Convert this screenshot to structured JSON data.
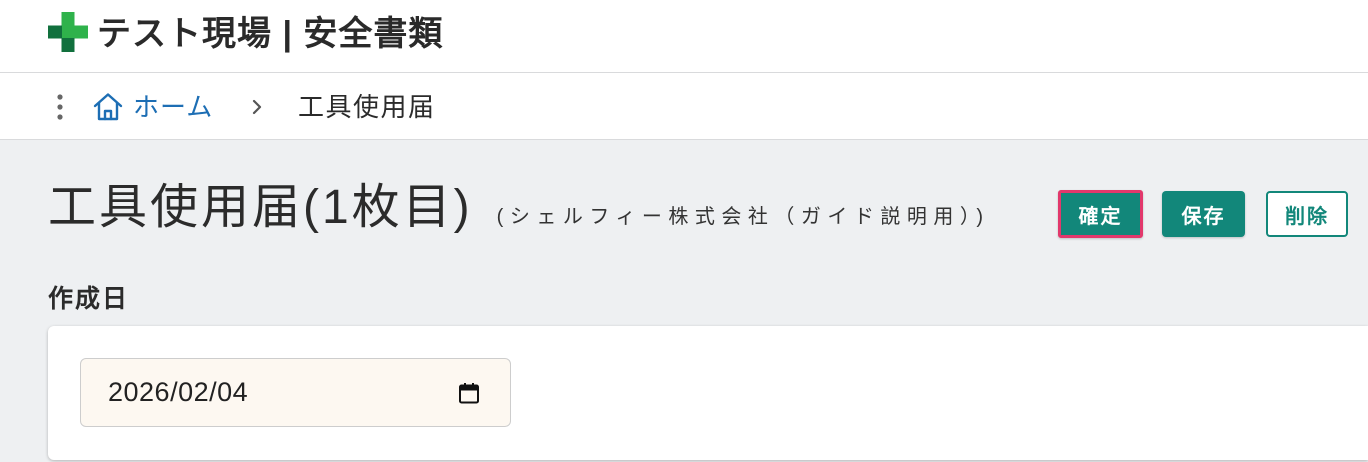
{
  "colors": {
    "brand": "#12877a",
    "highlight": "#e2386c",
    "link": "#1d6eb4",
    "background": "#eef0f2",
    "input_background": "#fdf8f1",
    "logo_light": "#2fb24b",
    "logo_dark": "#11703d"
  },
  "header": {
    "logo_icon": "green-cross-logo",
    "title": "テスト現場 | 安全書類"
  },
  "breadcrumb": {
    "menu_icon": "kebab-menu-icon",
    "home": {
      "icon": "home-icon",
      "label": "ホーム"
    },
    "separator_icon": "chevron-right-icon",
    "current": "工具使用届"
  },
  "page": {
    "title": "工具使用届(1枚目)",
    "subtitle": "(シェルフィー株式会社（ガイド説明用）)"
  },
  "actions": {
    "confirm": {
      "label": "確定"
    },
    "save": {
      "label": "保存"
    },
    "delete": {
      "label": "削除"
    }
  },
  "form": {
    "created_date": {
      "label": "作成日",
      "value": "2026/02/04",
      "icon": "calendar-icon"
    }
  }
}
